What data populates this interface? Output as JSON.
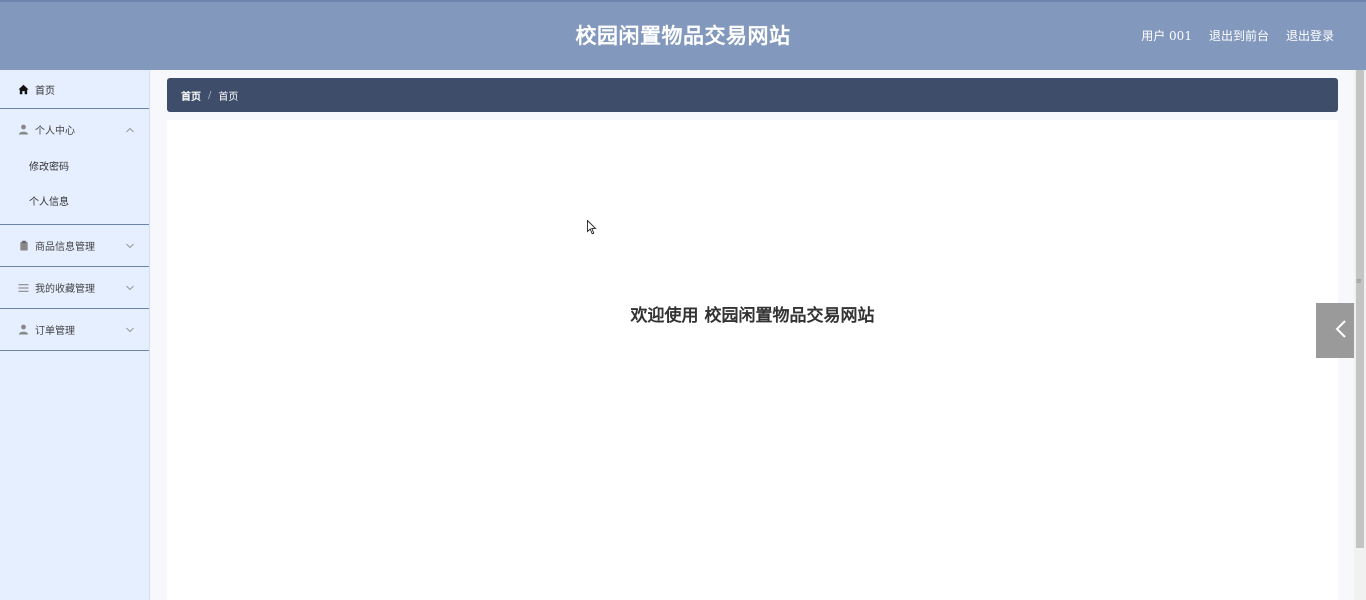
{
  "header": {
    "title": "校园闲置物品交易网站",
    "links": [
      "用户 001",
      "退出到前台",
      "退出登录"
    ]
  },
  "sidebar": {
    "home_label": "首页",
    "personal_center": {
      "label": "个人中心",
      "items": [
        "修改密码",
        "个人信息"
      ]
    },
    "groups": [
      {
        "label": "商品信息管理",
        "icon": "clipboard-icon"
      },
      {
        "label": "我的收藏管理",
        "icon": "list-icon"
      },
      {
        "label": "订单管理",
        "icon": "user-icon"
      }
    ]
  },
  "breadcrumb": {
    "root": "首页",
    "separator": "/",
    "current": "首页"
  },
  "main": {
    "welcome": "欢迎使用 校园闲置物品交易网站"
  },
  "colors": {
    "header_bg": "#8298bd",
    "sidebar_bg": "#e6efff",
    "breadcrumb_bg": "#3e4d69",
    "divider": "#6d84ac"
  }
}
